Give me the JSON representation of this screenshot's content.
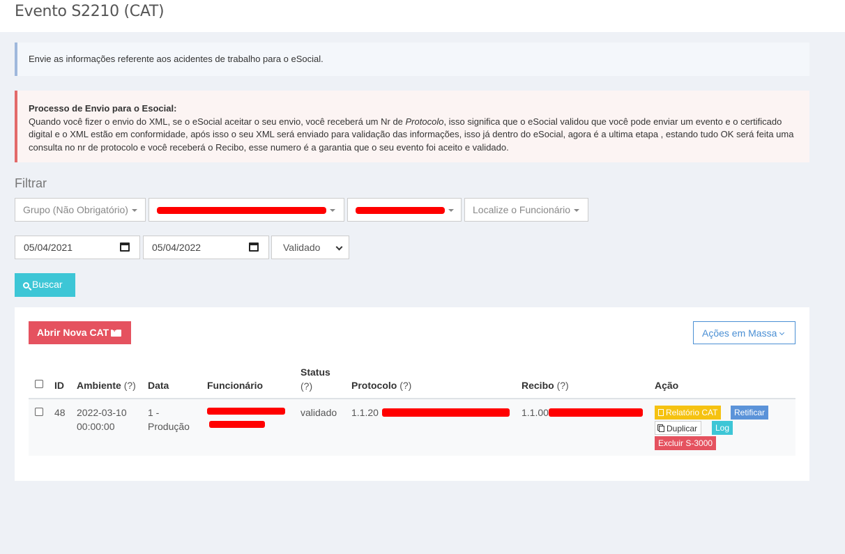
{
  "header": {
    "title": "Evento S2210 (CAT)"
  },
  "info": {
    "text": "Envie as informações referente aos acidentes de trabalho para o eSocial."
  },
  "alert": {
    "title": "Processo de Envio para o Esocial:",
    "text_part1": "Quando você fizer o envio do XML, se o eSocial aceitar o seu envio, você receberá um Nr de ",
    "text_italic": "Protocolo",
    "text_part2": ", isso significa que o eSocial validou que você pode enviar um evento e o certificado digital e o XML estão em conformidade, após isso o seu XML será enviado para validação das informações, isso já dentro do eSocial, agora é a ultima etapa , estando tudo OK será feita uma consulta no nr de protocolo e você receberá o Recibo, esse numero é a garantia que o seu evento foi aceito e validado."
  },
  "filter": {
    "label": "Filtrar",
    "grupo": "Grupo (Não Obrigatório)",
    "funcionario": "Localize o Funcionário",
    "date_from": "05/04/2021",
    "date_to": "05/04/2022",
    "status": "Validado",
    "search_button": "Buscar"
  },
  "panel": {
    "new_button": "Abrir Nova CAT",
    "bulk_button": "Ações em Massa",
    "columns": {
      "id": "ID",
      "ambiente": "Ambiente",
      "data": "Data",
      "funcionario": "Funcionário",
      "status": "Status",
      "protocolo": "Protocolo",
      "recibo": "Recibo",
      "acao": "Ação",
      "hint": "(?)"
    },
    "rows": [
      {
        "id": "48",
        "ambiente_line1": "2022-03-10",
        "ambiente_line2": "00:00:00",
        "data_line1": "1 -",
        "data_line2": "Produção",
        "status": "validado",
        "protocolo_prefix": "1.1.20",
        "recibo_prefix": "1.1.00"
      }
    ],
    "actions": {
      "relatorio": "Relatório CAT",
      "retificar": "Retificar",
      "duplicar": "Duplicar",
      "log": "Log",
      "excluir": "Excluir S-3000"
    }
  },
  "colors": {
    "primary_cyan": "#3dc6d6",
    "danger": "#e5525f",
    "warning": "#f5c211",
    "info_blue": "#5b93d9"
  }
}
